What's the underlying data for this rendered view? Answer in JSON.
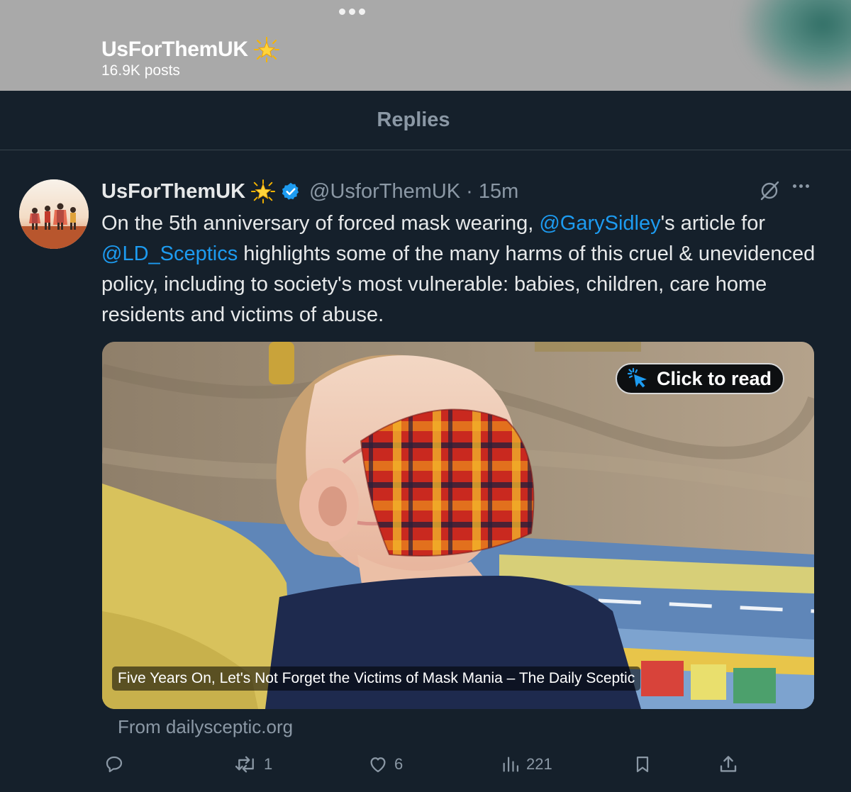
{
  "profile_header": {
    "name": "UsForThemUK",
    "badge": "glowing-star-emoji",
    "posts_count": "16.9K posts"
  },
  "tabs": [
    {
      "label": "Replies",
      "active": true
    }
  ],
  "tweet": {
    "author_name": "UsForThemUK",
    "author_badge": "glowing-star-emoji",
    "verified": true,
    "handle": "@UsforThemUK",
    "separator": "·",
    "time": "15m",
    "text_parts": {
      "p1": "On the 5th anniversary of forced mask wearing, ",
      "mention1": "@GarySidley",
      "p2": "'s article for ",
      "mention2": "@LD_Sceptics",
      "p3": " highlights some of the many harms of this cruel & unevidenced policy, including to society's most vulnerable: babies, children, care home residents and victims of abuse."
    },
    "card": {
      "overlay_button": "Click to read",
      "caption": "Five Years On, Let's Not Forget the Victims of Mask Mania – The Daily Sceptic",
      "from": "From dailysceptic.org"
    },
    "actions": {
      "replies": "",
      "reposts": "1",
      "likes": "6",
      "views": "221"
    }
  },
  "colors": {
    "background": "#15202b",
    "header_bar": "#a9a9a9",
    "accent": "#1d9bf0",
    "muted_text": "#8b98a5",
    "primary_text": "#e7e9ea"
  }
}
